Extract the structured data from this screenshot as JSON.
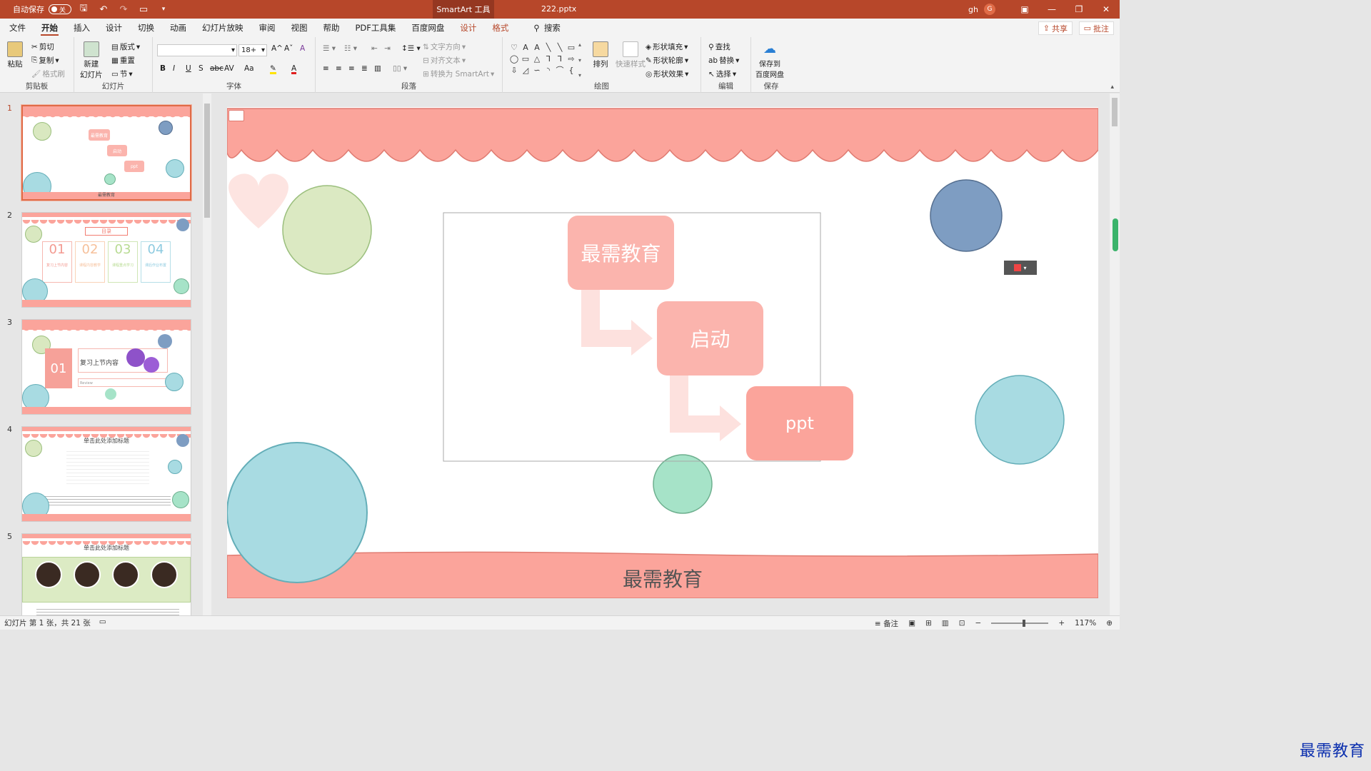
{
  "titlebar": {
    "autosave_label": "自动保存",
    "autosave_state": "关",
    "context_tab": "SmartArt 工具",
    "doc_title": "222.pptx",
    "user_name": "gh",
    "user_initial": "G"
  },
  "menu": {
    "items": [
      "文件",
      "开始",
      "插入",
      "设计",
      "切换",
      "动画",
      "幻灯片放映",
      "审阅",
      "视图",
      "帮助",
      "PDF工具集",
      "百度网盘"
    ],
    "context_items": [
      "设计",
      "格式"
    ],
    "search_label": "搜索",
    "share_label": "共享",
    "comment_label": "批注"
  },
  "ribbon": {
    "clipboard": {
      "paste": "粘贴",
      "cut": "剪切",
      "copy": "复制",
      "format_painter": "格式刷",
      "label": "剪贴板"
    },
    "slides": {
      "new_slide": "新建\n幻灯片",
      "layout": "版式",
      "reset": "重置",
      "section": "节",
      "label": "幻灯片"
    },
    "font": {
      "font_size": "18+",
      "label": "字体",
      "bold": "B",
      "italic": "I",
      "underline": "U",
      "shadow": "S",
      "strike": "abc",
      "spacing": "AV",
      "case": "Aa",
      "grow": "A^",
      "shrink": "Aˇ",
      "clear": "A"
    },
    "paragraph": {
      "text_direction": "文字方向",
      "align_text": "对齐文本",
      "convert_smartart": "转换为 SmartArt",
      "label": "段落"
    },
    "drawing": {
      "arrange": "排列",
      "quick_styles": "快速样式",
      "shape_fill": "形状填充",
      "shape_outline": "形状轮廓",
      "shape_effects": "形状效果",
      "label": "绘图"
    },
    "editing": {
      "find": "查找",
      "replace": "替换",
      "select": "选择",
      "label": "编辑"
    },
    "save": {
      "save_baidu": "保存到\n百度网盘",
      "label": "保存"
    }
  },
  "thumbnails": [
    {
      "num": "1",
      "title": "最需教育",
      "box1": "最需教育",
      "box2": "启动",
      "box3": "ppt"
    },
    {
      "num": "2",
      "heading": "目录",
      "items": [
        "01",
        "02",
        "03",
        "04"
      ],
      "captions": [
        "复习上节内容",
        "课程内容教学",
        "课程重点学习",
        "课后作业布置"
      ]
    },
    {
      "num": "3",
      "badge": "01",
      "title": "复习上节内容",
      "sub": "Review"
    },
    {
      "num": "4",
      "title": "单击此处添加标题"
    },
    {
      "num": "5",
      "title": "单击此处添加标题"
    }
  ],
  "slide": {
    "box1": "最需教育",
    "box2": "启动",
    "box3": "ppt",
    "footer": "最需教育"
  },
  "status": {
    "slide_info": "幻灯片 第 1 张，共 21 张",
    "notes": "备注",
    "zoom": "117%"
  },
  "watermark": "最需教育",
  "colors": {
    "accent": "#b7472a",
    "scallop": "#fba49b",
    "smartart": "#fbb4ad"
  }
}
